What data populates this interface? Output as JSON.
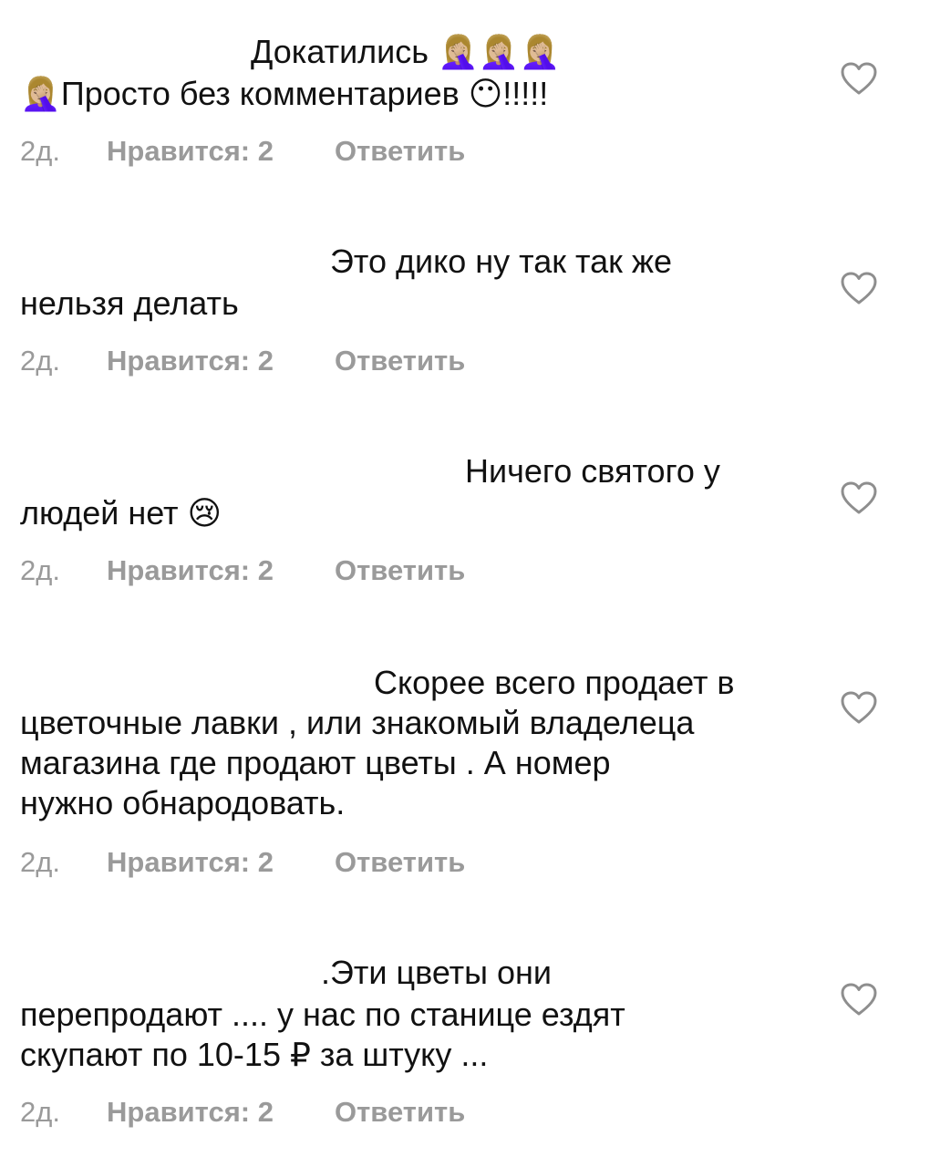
{
  "comments": [
    {
      "lines": [
        "Докатились 🤦🏼‍♀️🤦🏼‍♀️🤦🏼‍♀️",
        "🤦🏼‍♀️Просто без комментариев 😶!!!!!"
      ],
      "time": "2д.",
      "likes": "Нравится: 2",
      "reply": "Ответить"
    },
    {
      "lines": [
        "Это дико ну так так же",
        "нельзя делать"
      ],
      "time": "2д.",
      "likes": "Нравится: 2",
      "reply": "Ответить"
    },
    {
      "lines": [
        "Ничего святого у",
        "людей нет 😢"
      ],
      "time": "2д.",
      "likes": "Нравится: 2",
      "reply": "Ответить"
    },
    {
      "lines": [
        "Скорее всего продает в",
        "цветочные лавки , или знакомый владелеца",
        "магазина где продают цветы . А номер",
        "нужно обнародовать."
      ],
      "time": "2д.",
      "likes": "Нравится: 2",
      "reply": "Ответить"
    },
    {
      "lines": [
        ".Эти цветы они",
        "перепродают .... у нас по станице ездят",
        "скупают по 10-15 ₽ за штуку ..."
      ],
      "time": "2д.",
      "likes": "Нравится: 2",
      "reply": "Ответить"
    }
  ],
  "icons": {
    "like": "heart-outline-icon"
  },
  "colors": {
    "text": "#111111",
    "meta": "#9a9a9a",
    "heart": "#8e8e8e"
  }
}
